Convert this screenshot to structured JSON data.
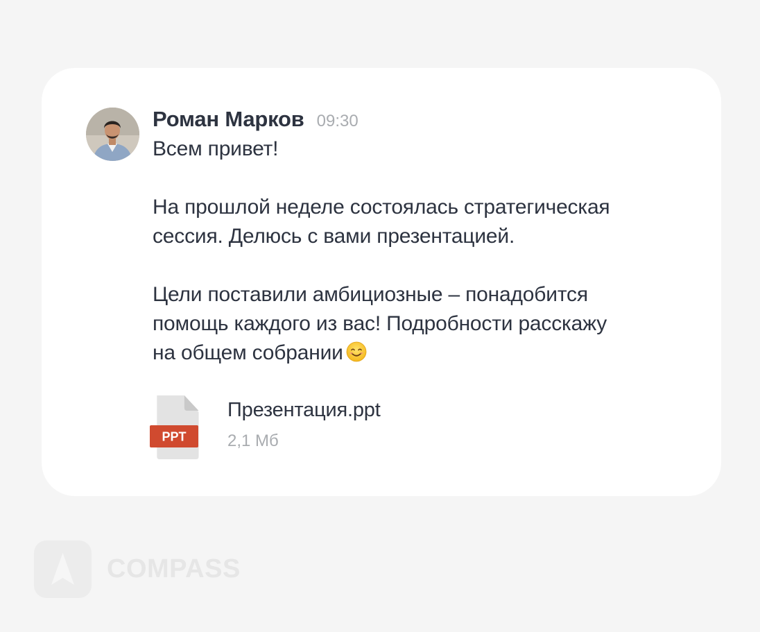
{
  "message": {
    "author": "Роман Марков",
    "time": "09:30",
    "paragraphs": [
      "Всем привет!",
      "На прошлой неделе состоялась стратегическая\nсессия. Делюсь с вами презентацией.",
      "Цели поставили амбициозные – понадобится\nпомощь каждого из вас! Подробности расскажу\nна общем собрании"
    ],
    "emoji": "smiling-face-emoji"
  },
  "attachment": {
    "type_label": "PPT",
    "file_name": "Презентация.ppt",
    "file_size": "2,1 Мб",
    "badge_color": "#d04a2f"
  },
  "brand": {
    "name": "COMPASS",
    "icon": "compass-arrow-icon"
  },
  "colors": {
    "background": "#f5f5f5",
    "card": "#ffffff",
    "text": "#2d3340",
    "muted": "#a9acb0"
  }
}
